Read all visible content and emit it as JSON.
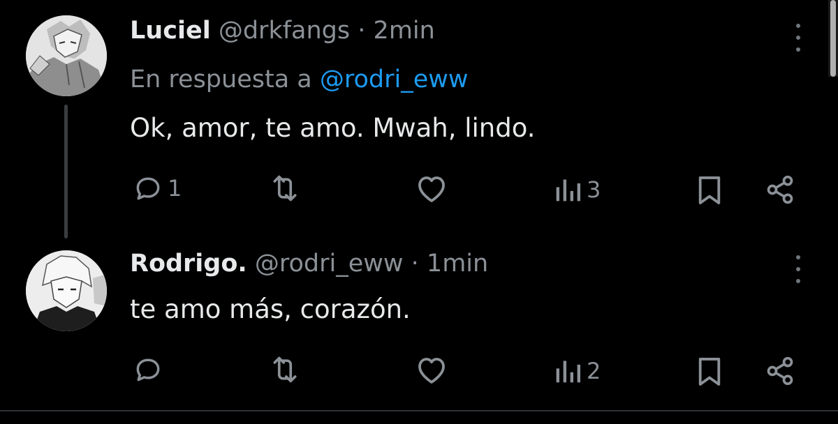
{
  "tweets": [
    {
      "name": "Luciel",
      "handle": "@drkfangs",
      "separator": "·",
      "time": "2min",
      "reply_prefix": "En respuesta a",
      "reply_to": "@rodri_eww",
      "text": "Ok, amor, te amo. Mwah, lindo.",
      "replies": "1",
      "views": "3"
    },
    {
      "name": "Rodrigo.",
      "handle": "@rodri_eww",
      "separator": "·",
      "time": "1min",
      "text": "te amo más, corazón.",
      "replies": "",
      "views": "2"
    }
  ],
  "colors": {
    "background": "#000000",
    "mention": "#1d9bf0",
    "muted": "#8b9197"
  },
  "icons": [
    "reply-icon",
    "retweet-icon",
    "like-icon",
    "views-icon",
    "bookmark-icon",
    "share-icon",
    "more-icon"
  ]
}
